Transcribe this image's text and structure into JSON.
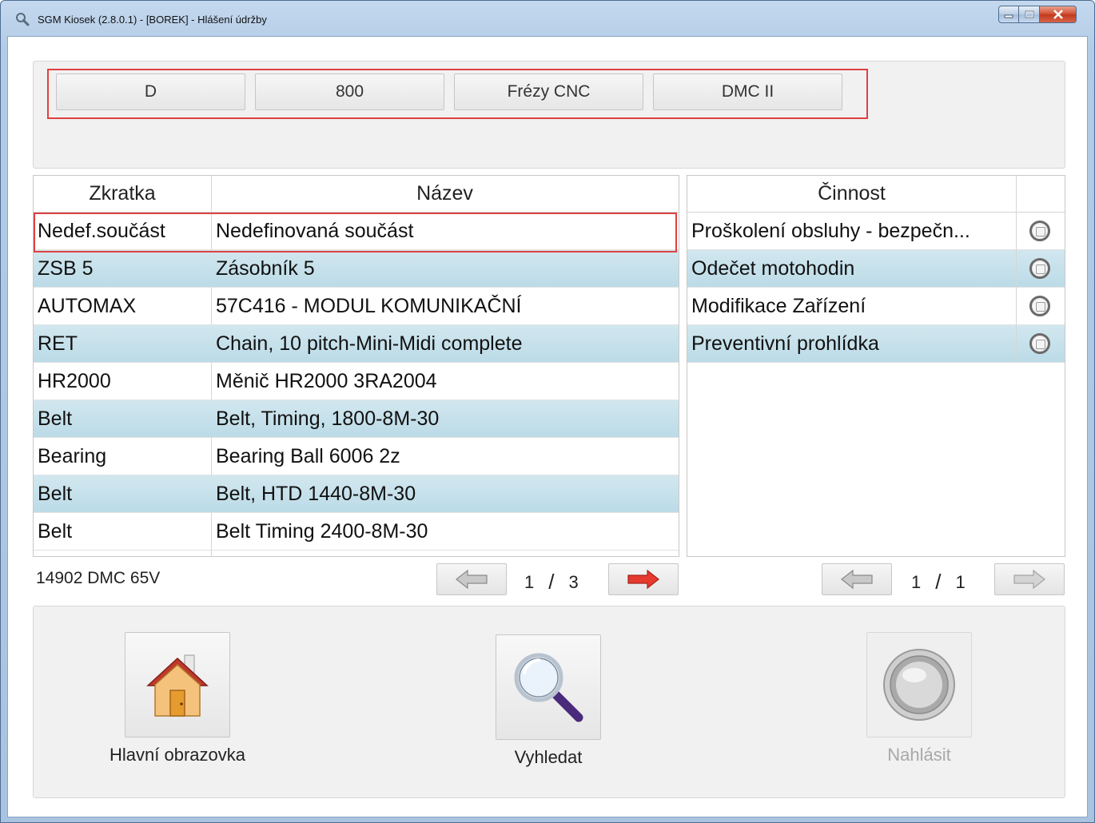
{
  "window": {
    "title": "SGM Kiosek (2.8.0.1) - [BOREK] - Hlášení údržby"
  },
  "filters": [
    "D",
    "800",
    "Frézy CNC",
    "DMC II"
  ],
  "parts": {
    "headers": {
      "code": "Zkratka",
      "name": "Název"
    },
    "rows": [
      {
        "code": "Nedef.součást",
        "name": "Nedefinovaná součást",
        "selected": true
      },
      {
        "code": "ZSB 5",
        "name": "Zásobník 5"
      },
      {
        "code": "AUTOMAX",
        "name": "57C416 - MODUL KOMUNIKAČNÍ"
      },
      {
        "code": "RET",
        "name": "Chain, 10 pitch-Mini-Midi complete"
      },
      {
        "code": "HR2000",
        "name": "Měnič HR2000 3RA2004"
      },
      {
        "code": "Belt",
        "name": "Belt, Timing,  1800-8M-30"
      },
      {
        "code": "Bearing",
        "name": "Bearing Ball 6006 2z"
      },
      {
        "code": "Belt",
        "name": "Belt, HTD 1440-8M-30"
      },
      {
        "code": "Belt",
        "name": "Belt Timing  2400-8M-30"
      }
    ],
    "pager": {
      "current": "1",
      "separator": "/",
      "total": "3"
    }
  },
  "activities": {
    "header": "Činnost",
    "rows": [
      {
        "label": "Proškolení obsluhy - bezpečn..."
      },
      {
        "label": "Odečet motohodin"
      },
      {
        "label": "Modifikace Zařízení"
      },
      {
        "label": "Preventivní prohlídka"
      }
    ],
    "pager": {
      "current": "1",
      "separator": "/",
      "total": "1"
    }
  },
  "machine_info": "14902 DMC 65V",
  "actions": {
    "home": "Hlavní obrazovka",
    "search": "Vyhledat",
    "report": "Nahlásit"
  },
  "colors": {
    "selection_border": "#e04040",
    "alt_row": "#c6e1eb",
    "next_arrow_active": "#e53a2e",
    "disabled_text": "#a9a9a9"
  }
}
